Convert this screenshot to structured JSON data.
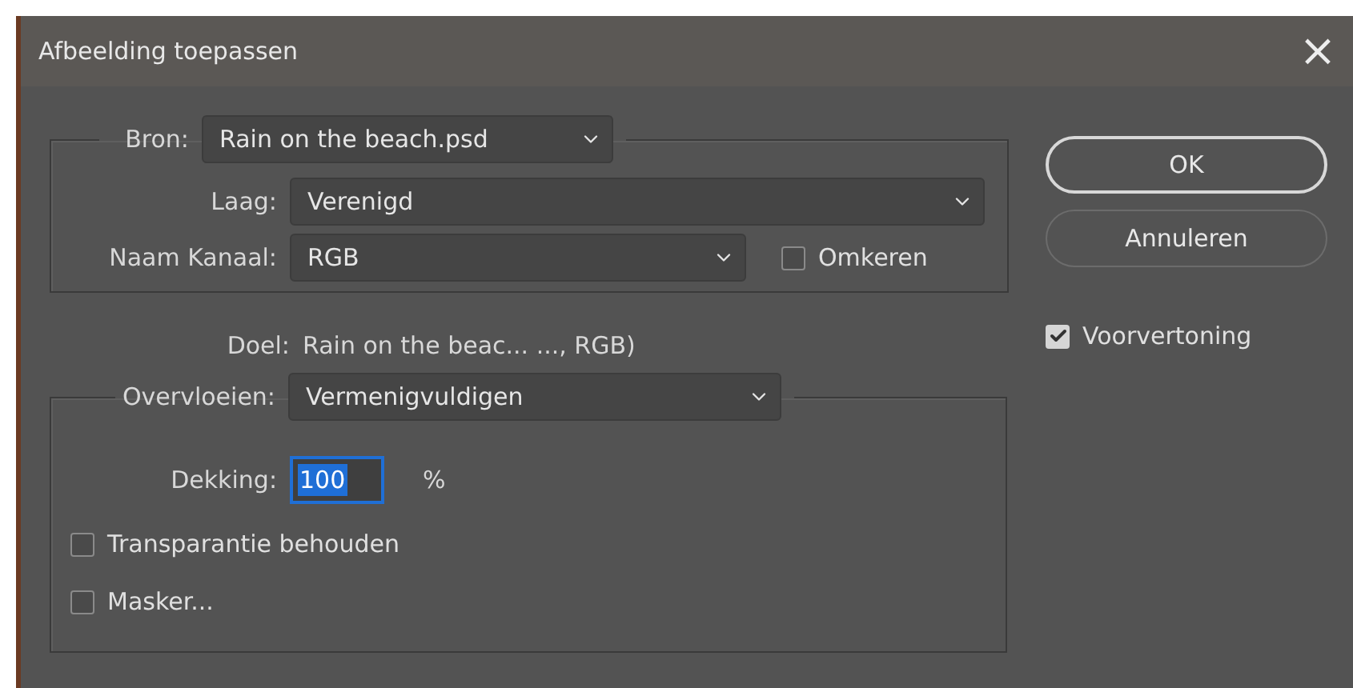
{
  "window": {
    "title": "Afbeelding toepassen",
    "close": "×"
  },
  "source": {
    "label": "Bron:",
    "value": "Rain on the beach.psd"
  },
  "layer": {
    "label": "Laag:",
    "value": "Verenigd"
  },
  "channel": {
    "label": "Naam Kanaal:",
    "value": "RGB"
  },
  "invert": {
    "label": "Omkeren",
    "checked": false
  },
  "target": {
    "label": "Doel:",
    "value": "Rain on the beac... ..., RGB)"
  },
  "blending": {
    "label": "Overvloeien:",
    "value": "Vermenigvuldigen"
  },
  "opacity": {
    "label": "Dekking:",
    "value": "100",
    "unit": "%"
  },
  "options": [
    {
      "label": "Transparantie behouden",
      "checked": false
    },
    {
      "label": "Masker...",
      "checked": false
    }
  ],
  "buttons": [
    {
      "label": "OK",
      "default": true
    },
    {
      "label": "Annuleren",
      "default": false
    }
  ],
  "preview": {
    "label": "Voorvertoning",
    "checked": true
  }
}
